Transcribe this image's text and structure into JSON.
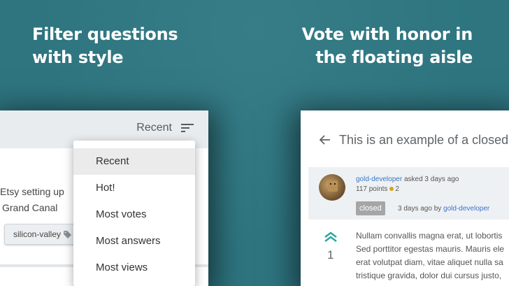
{
  "headlines": {
    "left_line1": "Filter questions",
    "left_line2": "with style",
    "right_line1": "Vote with honor in",
    "right_line2": "the floating aisle"
  },
  "filter_screen": {
    "sort_label": "Recent",
    "card_line1": "Etsy setting up",
    "card_line2": "Grand Canal",
    "tag_label": "silicon-valley",
    "menu_items": [
      "Recent",
      "Hot!",
      "Most votes",
      "Most answers",
      "Most views"
    ]
  },
  "question_screen": {
    "title": "This is an example of a closed",
    "author": "gold-developer",
    "asked_text": "asked 3 days ago",
    "points_text": "117 points",
    "badge_count": "2",
    "closed_label": "closed",
    "closed_meta_prefix": "3 days ago by",
    "closed_by": "gold-developer",
    "vote_count": "1",
    "body_lines": [
      "Nullam convallis magna erat, ut lobortis",
      "Sed porttitor egestas mauris. Mauris ele",
      "erat volutpat diam, vitae aliquet nulla sa",
      "tristique gravida, dolor dui cursus justo,"
    ]
  },
  "colors": {
    "background": "#2e7580",
    "link": "#3b74c8",
    "vote_arrow": "#27a79b",
    "badge_gold": "#d8a31b"
  }
}
